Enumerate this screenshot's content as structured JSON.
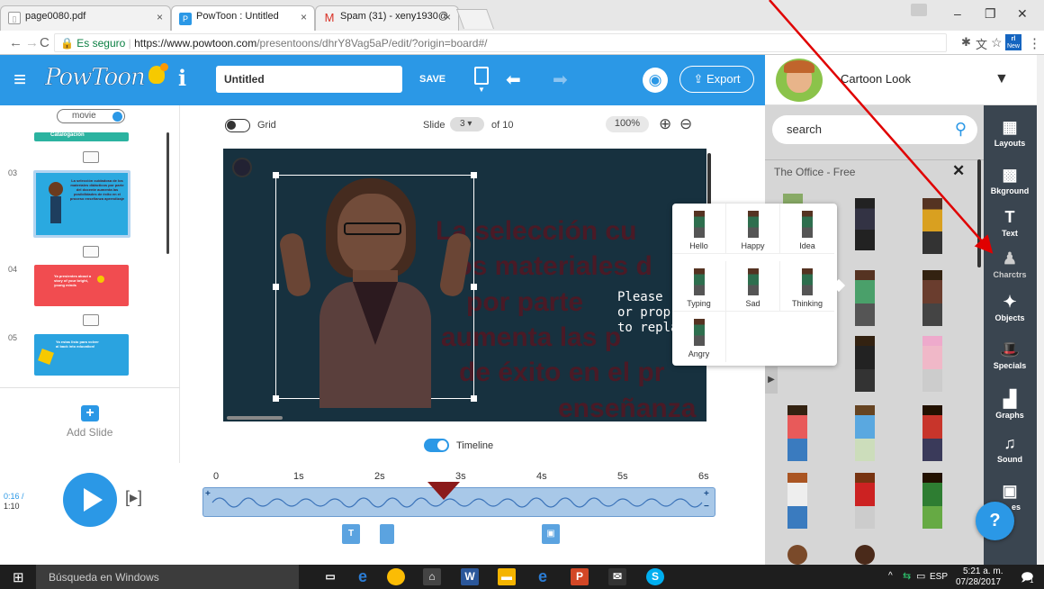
{
  "browser": {
    "tabs": [
      {
        "label": "page0080.pdf",
        "active": false
      },
      {
        "label": "PowToon : Untitled",
        "active": true
      },
      {
        "label": "Spam (31) - xeny1930@",
        "active": false
      }
    ],
    "url_secure": "Es seguro",
    "url_host": "https://www.powtoon.com",
    "url_path": "/presentoons/dhrY8Vag5aP/edit/?origin=board#/",
    "ext_badge": "New"
  },
  "toolbar": {
    "title_value": "Untitled",
    "save_label": "SAVE",
    "export_label": "Export",
    "style_label": "Cartoon Look"
  },
  "slides_panel": {
    "mode_label": "movie",
    "slides": [
      {
        "num": "",
        "caption": "Catalogación"
      },
      {
        "num": "03",
        "caption": "La selección cuidadosa de los materiales didácticos por parte del docente aumenta las posibilidades de éxito en el proceso enseñanza aprendizaje"
      },
      {
        "num": "04",
        "caption": "Ya presientes about a story of your bright, young minds"
      },
      {
        "num": "05",
        "caption": "Ya estas listo para volver al back into education!"
      }
    ],
    "add_slide_label": "Add Slide"
  },
  "canvas_toolbar": {
    "grid_label": "Grid",
    "slide_label": "Slide",
    "slide_current": "3",
    "slide_of": "of 10",
    "zoom": "100%"
  },
  "canvas": {
    "text_lines": [
      "La selección cu",
      "los materiales d",
      "por parte",
      "aumenta las p",
      "de éxito en el pr",
      "enseñanza"
    ],
    "placeholder": [
      "Please",
      "or prop",
      "to repla"
    ]
  },
  "pose_popup": {
    "poses": [
      "Hello",
      "Happy",
      "Idea",
      "Typing",
      "Sad",
      "Thinking",
      "Angry"
    ]
  },
  "library": {
    "search_placeholder": "search",
    "category": "The Office - Free"
  },
  "sidebar": {
    "items": [
      "Layouts",
      "Bkground",
      "Text",
      "Charctrs",
      "Objects",
      "Specials",
      "Graphs",
      "Sound",
      "es"
    ]
  },
  "timeline": {
    "toggle_label": "Timeline",
    "time_current": "0:16 /",
    "time_total": "1:10",
    "ticks": [
      "0",
      "1s",
      "2s",
      "3s",
      "4s",
      "5s",
      "6s"
    ],
    "playhead_fraction": 0.47
  },
  "help_label": "?",
  "taskbar": {
    "search_text": "Búsqueda en Windows",
    "lang": "ESP",
    "time": "5:21 a. m.",
    "date": "07/28/2017",
    "notif_count": "1"
  },
  "colors": {
    "brand_blue": "#2b98e6",
    "sidebar_dark": "#3a4550",
    "canvas_bg": "#17313f",
    "annotation_red": "#e00000"
  }
}
